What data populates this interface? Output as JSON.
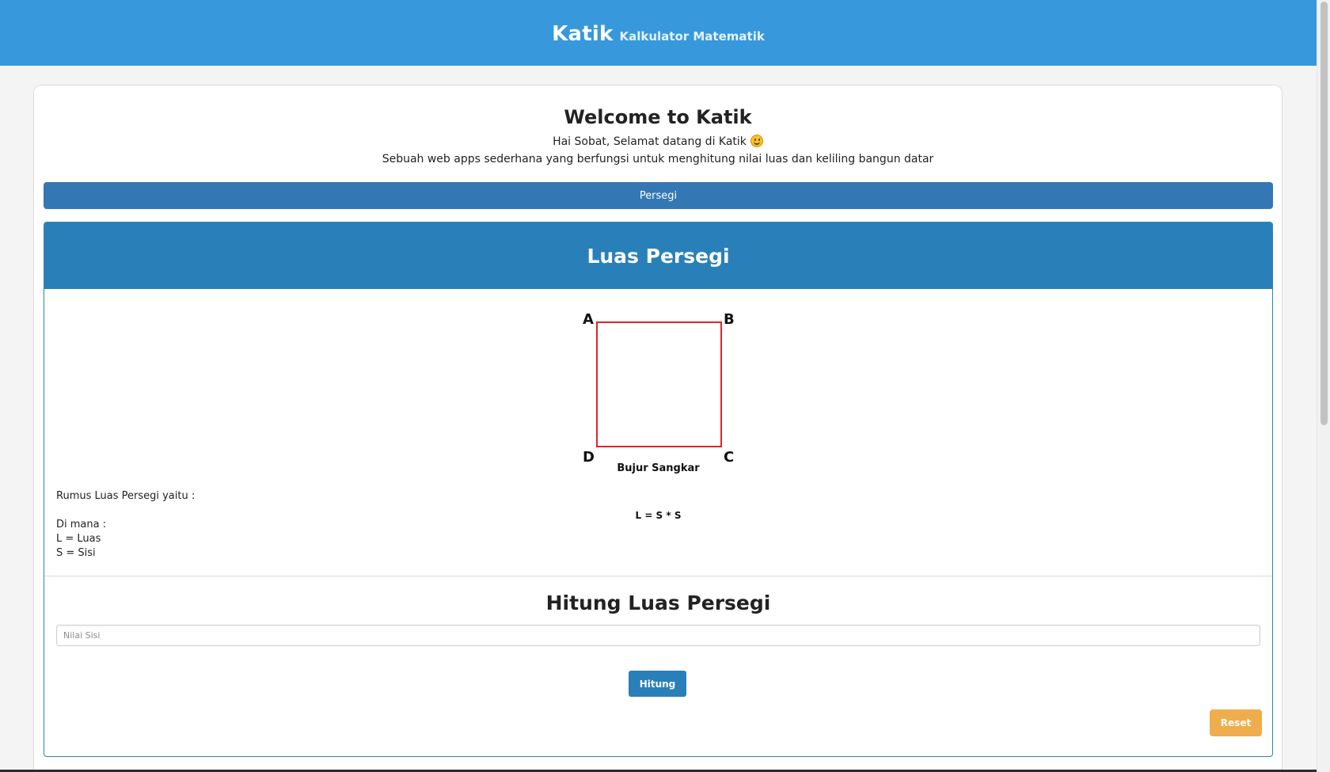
{
  "header": {
    "brand": "Katik",
    "subtitle": "Kalkulator Matematik"
  },
  "welcome": {
    "title": "Welcome to Katik",
    "greeting": "Hai Sobat, Selamat datang di Katik",
    "greeting_icon": "smiling-face-icon",
    "description": "Sebuah web apps sederhana yang berfungsi untuk menghitung nilai luas dan keliling bangun datar"
  },
  "shape_tab": {
    "label": "Persegi"
  },
  "calculator": {
    "title": "Luas Persegi",
    "figure": {
      "vertices": {
        "a": "A",
        "b": "B",
        "c": "C",
        "d": "D"
      },
      "caption": "Bujur Sangkar",
      "square_color": "#e2232a"
    },
    "formula": {
      "intro": "Rumus Luas Persegi yaitu :",
      "where": "Di mana :",
      "l_def": "L = Luas",
      "s_def": "S = Sisi",
      "expression": "L = S * S"
    },
    "form": {
      "title": "Hitung Luas Persegi",
      "input_placeholder": "Nilai Sisi",
      "input_value": "",
      "submit_label": "Hitung",
      "reset_label": "Reset"
    }
  },
  "colors": {
    "header_bg": "#3799dc",
    "tab_bg": "#3477b5",
    "card_header_bg": "#2980b9",
    "primary_button": "#2980b9",
    "reset_button": "#f0ad4e"
  }
}
